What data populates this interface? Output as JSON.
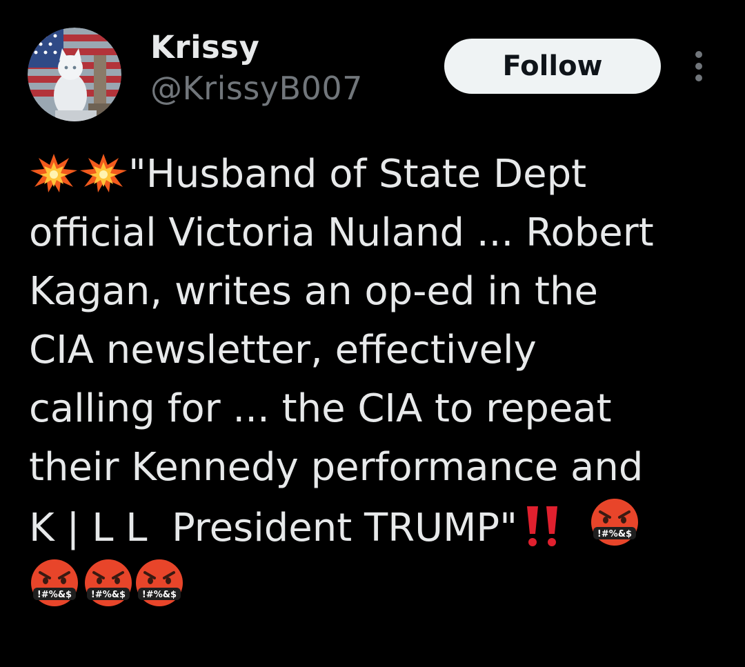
{
  "author": {
    "display_name": "Krissy",
    "handle": "@KrissyB007"
  },
  "actions": {
    "follow_label": "Follow"
  },
  "tweet": {
    "lines": [
      "\"Husband of State Dept",
      "official Victoria Nuland ... Robert",
      "Kagan, writes an op-ed in the",
      "CIA newsletter, effectively",
      "calling for ... the CIA to repeat",
      "their Kennedy performance and",
      "K | L L  President TRUMP\""
    ],
    "emoji_symbol_text": "!#%&$"
  },
  "colors": {
    "background": "#000000",
    "text_primary": "#e7e9ea",
    "text_secondary": "#71767b",
    "follow_button_bg": "#eff3f4",
    "follow_button_text": "#0f1419",
    "exclamation_red": "#e0202e",
    "angry_face": "#e8452a"
  },
  "icons": {
    "avatar": "avatar-cat-flag",
    "more": "more-vertical-icon",
    "collision": "collision-emoji",
    "double_exclamation": "double-exclamation-emoji",
    "cursing_face": "face-with-symbols-on-mouth-emoji"
  }
}
